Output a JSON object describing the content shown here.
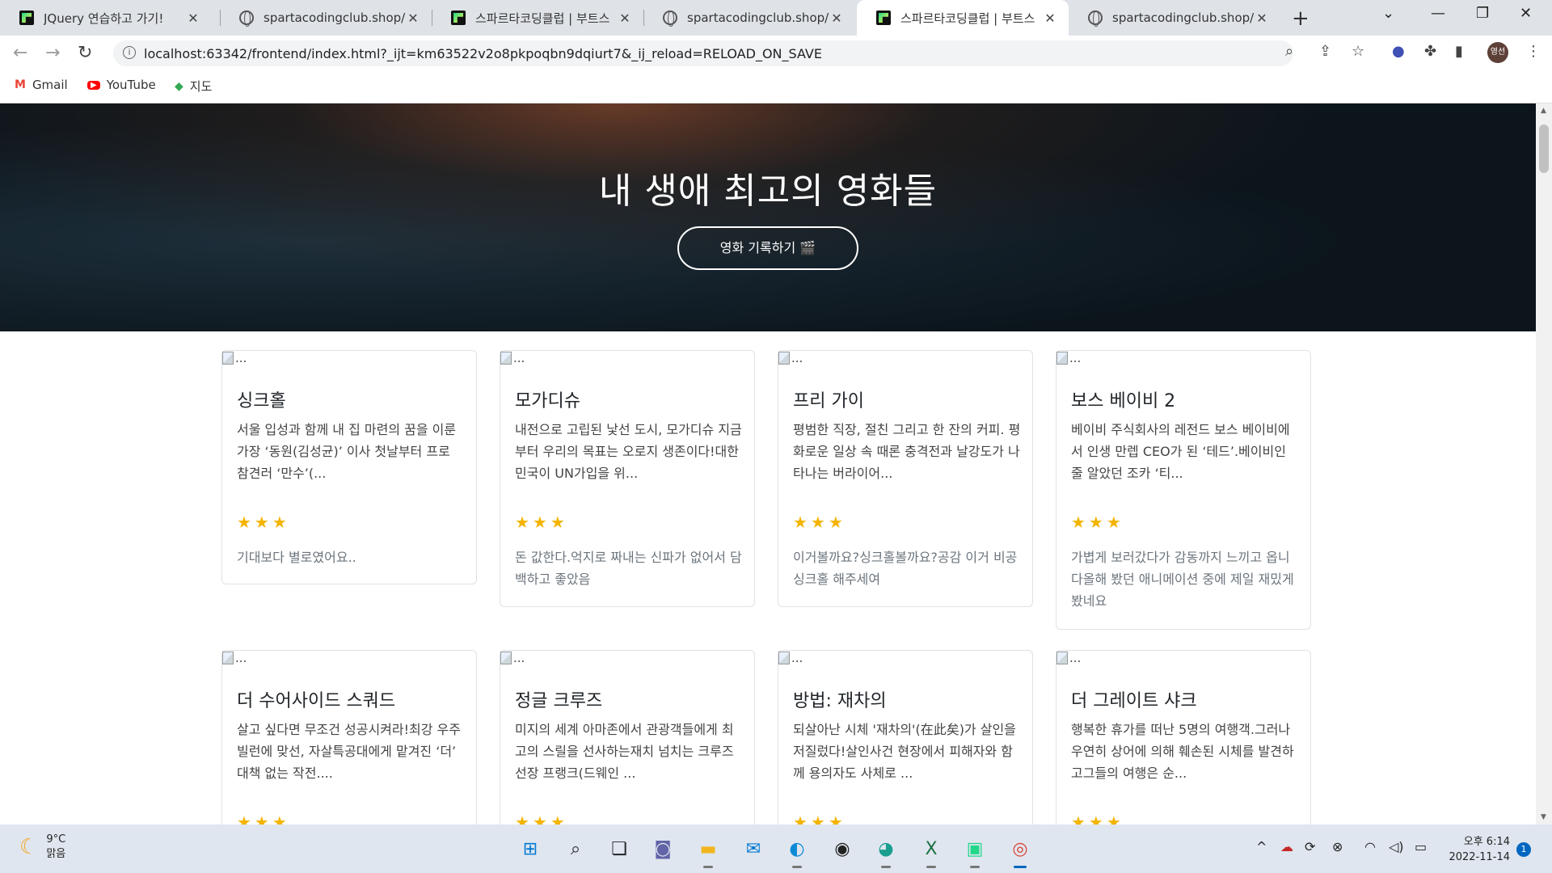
{
  "browser": {
    "tabs": [
      {
        "title": "JQuery 연습하고 가기!",
        "favicon": "pycharm-icon"
      },
      {
        "title": "spartacodingclub.shop/spa",
        "favicon": "globe-icon"
      },
      {
        "title": "스파르타코딩클럽 | 부트스",
        "favicon": "pycharm-icon"
      },
      {
        "title": "spartacodingclub.shop/wel",
        "favicon": "globe-icon"
      },
      {
        "title": "스파르타코딩클럽 | 부트스",
        "favicon": "pycharm-icon",
        "active": true
      },
      {
        "title": "spartacodingclub.shop/wel",
        "favicon": "globe-icon"
      }
    ],
    "url": "localhost:63342/frontend/index.html?_ijt=km63522v2o8pkpoqbn9dqiurt7&_ij_reload=RELOAD_ON_SAVE",
    "profile_label": "영선",
    "bookmarks": [
      {
        "label": "Gmail"
      },
      {
        "label": "YouTube"
      },
      {
        "label": "지도"
      }
    ]
  },
  "page": {
    "hero_title": "내 생애 최고의 영화들",
    "hero_button": "영화 기록하기 🎬",
    "image_alt": "...",
    "cards": [
      {
        "title": "싱크홀",
        "text": "서울 입성과 함께 내 집 마련의 꿈을 이룬 가장 ‘동원(김성균)’ 이사 첫날부터 프로 참견러 ‘만수’(...",
        "stars": "★★★",
        "comment": "기대보다 별로였어요.."
      },
      {
        "title": "모가디슈",
        "text": "내전으로 고립된 낯선 도시, 모가디슈 지금부터 우리의 목표는 오로지 생존이다!대한민국이 UN가입을 위...",
        "stars": "★★★",
        "comment": "돈 값한다.억지로 짜내는 신파가 없어서 담백하고 좋았음"
      },
      {
        "title": "프리 가이",
        "text": "평범한 직장, 절친 그리고 한 잔의 커피. 평화로운 일상 속 때론 충격전과 날강도가 나타나는 버라이어...",
        "stars": "★★★",
        "comment": "이거볼까요?싱크홀볼까요?공감 이거 비공 싱크홀 해주세여"
      },
      {
        "title": "보스 베이비 2",
        "text": "베이비 주식회사의 레전드 보스 베이비에서 인생 만렙 CEO가 된 ‘테드’.베이비인 줄 알았던 조카 ‘티...",
        "stars": "★★★",
        "comment": "가볍게 보러갔다가 감동까지 느끼고 옵니다올해 봤던 애니메이션 중에 제일 재밌게 봤네요"
      },
      {
        "title": "더 수어사이드 스쿼드",
        "text": "살고 싶다면 무조건 성공시켜라!최강 우주 빌런에 맞선, 자살특공대에게 맡겨진 ‘더’ 대책 없는 작전....",
        "stars": "★★★",
        "comment": ""
      },
      {
        "title": "정글 크루즈",
        "text": "미지의 세계 아마존에서 관광객들에게 최고의 스릴을 선사하는재치 넘치는 크루즈 선장 프랭크(드웨인 ...",
        "stars": "★★★",
        "comment": ""
      },
      {
        "title": "방법: 재차의",
        "text": "되살아난 시체 '재차의'(在此矣)가 살인을 저질렀다!살인사건 현장에서 피해자와 함께 용의자도 사체로 ...",
        "stars": "★★★",
        "comment": ""
      },
      {
        "title": "더 그레이트 샤크",
        "text": "행복한 휴가를 떠난 5명의 여행객.그러나 우연히 상어에 의해 훼손된 시체를 발견하고그들의 여행은 순...",
        "stars": "★★★",
        "comment": ""
      }
    ]
  },
  "taskbar": {
    "weather_temp": "9°C",
    "weather_desc": "맑음",
    "time": "오후 6:14",
    "date": "2022-11-14",
    "notification_count": "1"
  }
}
